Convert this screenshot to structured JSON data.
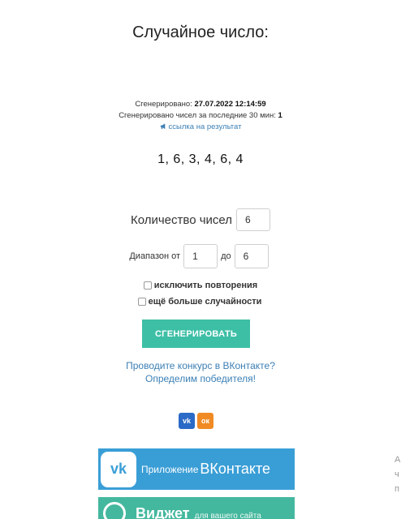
{
  "page": {
    "title": "Случайное число:"
  },
  "generation": {
    "generated_label": "Сгенерировано:",
    "generated_value": "27.07.2022 12:14:59",
    "count_label": "Сгенерировано чисел за последние 30 мин:",
    "count_value": "1",
    "link_text": "ссылка на результат"
  },
  "result": {
    "numbers": "1, 6, 3, 4, 6, 4"
  },
  "form": {
    "count_label": "Количество чисел",
    "count_value": "6",
    "range_from_label": "Диапазон от",
    "range_from_value": "1",
    "range_to_label": "до",
    "range_to_value": "6",
    "exclude_repeats_label": "исключить повторения",
    "exclude_repeats_checked": false,
    "more_random_label": "ещё больше случайности",
    "more_random_checked": false,
    "generate_button": "СГЕНЕРИРОВАТЬ"
  },
  "promo": {
    "line1": "Проводите конкурс в ВКонтакте?",
    "line2": "Определим победителя!"
  },
  "share": {
    "vk_glyph": "vk",
    "ok_glyph": "ок"
  },
  "banners": {
    "vk_app_logo": "vk",
    "vk_app_small": "Приложение",
    "vk_app_big": "ВКонтакте",
    "widget_big": "Виджет",
    "widget_small": "для вашего сайта"
  },
  "side_clip": {
    "line1": "А",
    "line2": "ч",
    "line3": "п"
  },
  "colors": {
    "accent": "#3dbfa6",
    "link": "#3b7fb5",
    "vk_banner": "#3a9ed6",
    "widget_banner": "#44b89e",
    "vk_share": "#2b6ac6",
    "ok_share": "#f08a24"
  }
}
